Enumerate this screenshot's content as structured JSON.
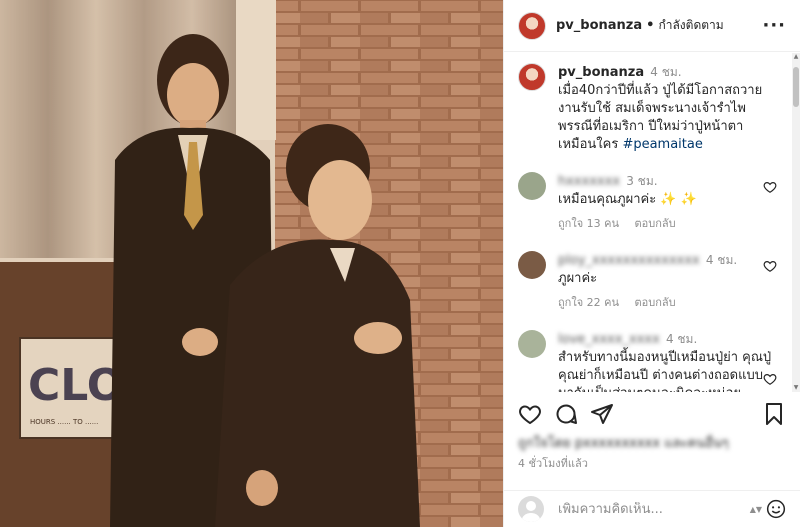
{
  "photo": {
    "sign_text": "CLOSE",
    "sign_small": "HOURS ...... TO ......"
  },
  "header": {
    "username": "pv_bonanza",
    "separator": "•",
    "follow_label": "กำลังติดตาม",
    "more_label": "···"
  },
  "caption": {
    "username": "pv_bonanza",
    "time": "4 ชม.",
    "text": "เมื่อ40กว่าปีที่แล้ว ปู่ได้มีโอกาสถวายงานรับใช้ สมเด็จพระนางเจ้ารำไพพรรณีที่อเมริกา ปีใหม่ว่าปู่หน้าตาเหมือนใคร ",
    "hashtag": "#peamaitae"
  },
  "comments": [
    {
      "username": "hxxxxxxx",
      "time": "3 ชม.",
      "text": "เหมือนคุณภูผาค่ะ ✨ ✨",
      "likes": "ถูกใจ 13 คน",
      "reply": "ตอบกลับ",
      "avatar_color": "#9aa58b"
    },
    {
      "username": "ploy_xxxxxxxxxxxxxx",
      "time": "4 ชม.",
      "text": "ภูผาค่ะ",
      "likes": "ถูกใจ 22 คน",
      "reply": "ตอบกลับ",
      "avatar_color": "#7a5b45"
    },
    {
      "username": "love_xxxx_xxxx",
      "time": "4 ชม.",
      "text": "สำหรับทางนี้มองหนูปีเหมือนปู่ย่า คุณปู่คุณย่าก็เหมือนปี ต่างคนต่างถอดแบบมากันเป็นส่วนๆคนละนิดละหน่อยประกอบกันเลยค่ะ น่ารัก",
      "likes": "",
      "reply": "",
      "avatar_color": "#a9b39a"
    }
  ],
  "actions": {
    "like_icon": "heart-icon",
    "comment_icon": "comment-icon",
    "share_icon": "send-icon",
    "save_icon": "bookmark-icon"
  },
  "likes_line": "ถูกใจโดย pxxxxxxxxxx และคนอื่นๆ",
  "post_time": "4 ชั่วโมงที่แล้ว",
  "add_comment": {
    "placeholder": "เพิ่มความคิดเห็น..."
  },
  "colors": {
    "accent_link": "#00376b",
    "muted": "#8e8e8e",
    "text": "#262626"
  }
}
